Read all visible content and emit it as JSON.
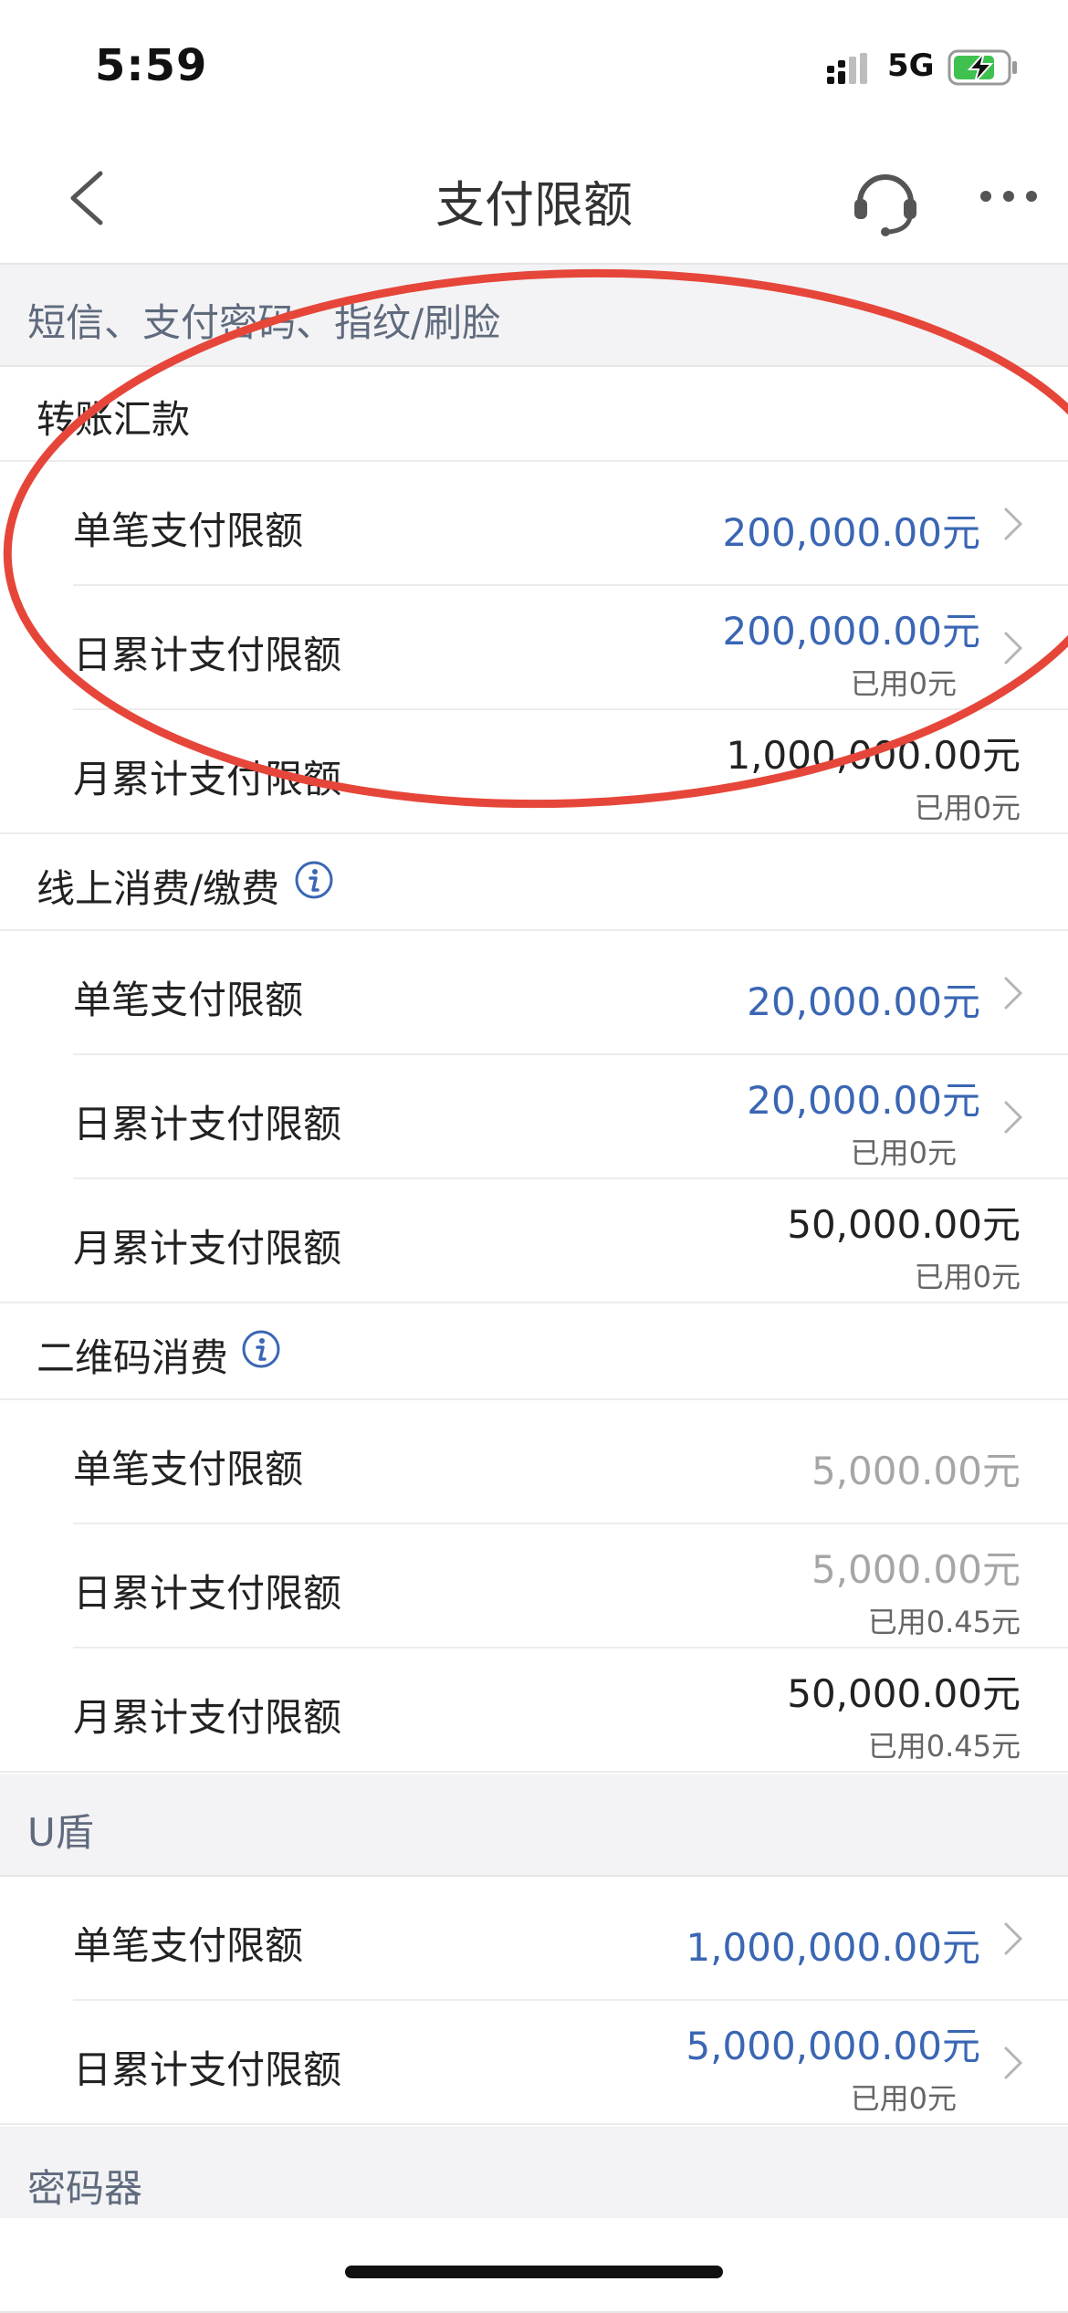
{
  "status_bar": {
    "time": "5:59",
    "network": "5G"
  },
  "nav": {
    "title": "支付限额",
    "back_icon": "chevron-left-icon",
    "headset_icon": "headset-icon",
    "more_icon": "more-dots-icon"
  },
  "colors": {
    "accent_blue": "#3a66b3",
    "annotation_red": "#e6463a",
    "section_bg": "#f3f3f5"
  },
  "sections": {
    "sms": {
      "title": "短信、支付密码、指纹/刷脸",
      "transfer": {
        "title": "转账汇款",
        "rows": [
          {
            "label": "单笔支付限额",
            "value": "200,000.00元"
          },
          {
            "label": "日累计支付限额",
            "value": "200,000.00元",
            "used": "已用0元"
          },
          {
            "label": "月累计支付限额",
            "value": "1,000,000.00元",
            "used": "已用0元"
          }
        ]
      },
      "online": {
        "title": "线上消费/缴费",
        "rows": [
          {
            "label": "单笔支付限额",
            "value": "20,000.00元"
          },
          {
            "label": "日累计支付限额",
            "value": "20,000.00元",
            "used": "已用0元"
          },
          {
            "label": "月累计支付限额",
            "value": "50,000.00元",
            "used": "已用0元"
          }
        ]
      },
      "qrcode": {
        "title": "二维码消费",
        "rows": [
          {
            "label": "单笔支付限额",
            "value": "5,000.00元"
          },
          {
            "label": "日累计支付限额",
            "value": "5,000.00元",
            "used": "已用0.45元"
          },
          {
            "label": "月累计支付限额",
            "value": "50,000.00元",
            "used": "已用0.45元"
          }
        ]
      }
    },
    "ushield": {
      "title": "U盾",
      "rows": [
        {
          "label": "单笔支付限额",
          "value": "1,000,000.00元"
        },
        {
          "label": "日累计支付限额",
          "value": "5,000,000.00元",
          "used": "已用0元"
        }
      ]
    },
    "token": {
      "title": "密码器"
    }
  }
}
